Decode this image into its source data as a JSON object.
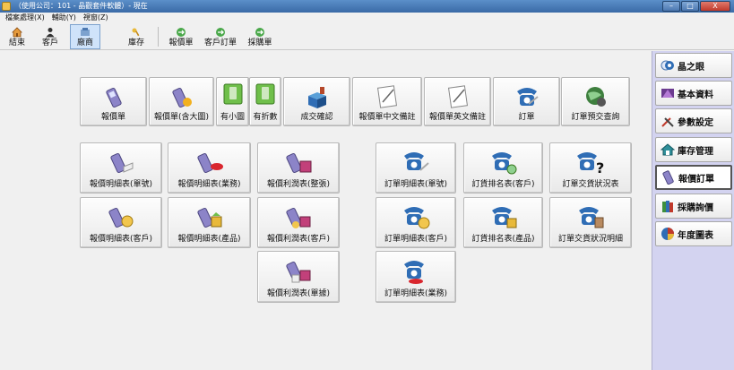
{
  "window": {
    "title": "（使用公司：101 - 晶觀套件軟體）- 現在",
    "controls": [
      "–",
      "□",
      "X"
    ]
  },
  "menubar": [
    "檔案處理(X)",
    "輔助(Y)",
    "視窗(Z)"
  ],
  "toolbar": {
    "items": [
      {
        "label": "結束",
        "icon": "exit-icon"
      },
      {
        "label": "客戶",
        "icon": "customer-icon"
      },
      {
        "label": "廠商",
        "icon": "vendor-icon",
        "active": true
      },
      {
        "label": "庫存",
        "icon": "inventory-icon"
      },
      {
        "label": "報價單",
        "icon": "quote-icon"
      },
      {
        "label": "客戶訂單",
        "icon": "customer-order-icon"
      },
      {
        "label": "採購單",
        "icon": "purchase-order-icon"
      }
    ]
  },
  "main": {
    "row1": [
      "報價單",
      "報價單(含大圖)",
      "有小圖",
      "有折數",
      "成交確認",
      "報價單中文備註",
      "報價單英文備註",
      "訂單",
      "訂單預交查詢"
    ],
    "quote_reports": [
      "報價明細表(單號)",
      "報價明細表(業務)",
      "報價利潤表(整張)",
      "報價明細表(客戶)",
      "報價明細表(產品)",
      "報價利潤表(客戶)",
      "報價利潤表(單據)"
    ],
    "order_reports": [
      "訂單明細表(單號)",
      "訂貨排名表(客戶)",
      "訂單交貨狀況表",
      "訂單明細表(客戶)",
      "訂貨排名表(產品)",
      "訂單交貨狀況明細",
      "訂單明細表(業務)"
    ]
  },
  "sidebar": {
    "items": [
      {
        "label": "晶之眼",
        "icon": "eye-icon"
      },
      {
        "label": "基本資料",
        "icon": "basic-data-icon"
      },
      {
        "label": "參數設定",
        "icon": "tools-icon"
      },
      {
        "label": "庫存管理",
        "icon": "house-icon"
      },
      {
        "label": "報價訂單",
        "icon": "phone-icon",
        "active": true
      },
      {
        "label": "採購詢價",
        "icon": "books-icon"
      },
      {
        "label": "年度圖表",
        "icon": "pie-chart-icon"
      }
    ]
  },
  "colors": {
    "titlebar": "#3a6aa6",
    "sidebar_bg": "#d3d3f0",
    "active_tool": "#cfe3fa",
    "phone_blue": "#2f6db5",
    "mobile_purple": "#8c84c8"
  }
}
